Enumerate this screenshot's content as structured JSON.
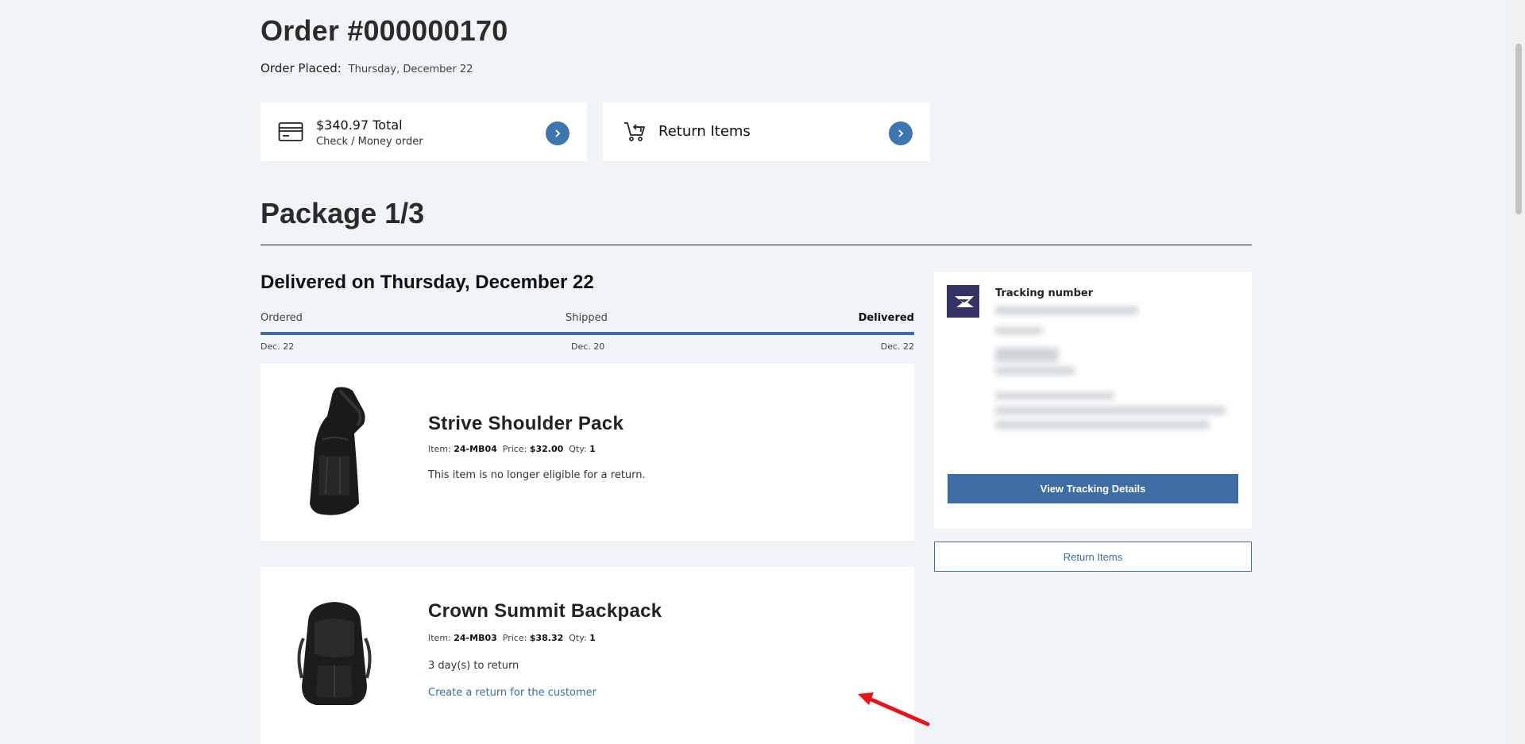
{
  "order": {
    "title": "Order #000000170",
    "placed_label": "Order Placed:",
    "placed_value": "Thursday, December 22"
  },
  "summary_cards": {
    "total_main": "$340.97 Total",
    "payment_method": "Check / Money order",
    "return_items_label": "Return Items",
    "icons": [
      "credit-card-icon",
      "cart-return-icon",
      "chevron-right-icon"
    ]
  },
  "package": {
    "title": "Package 1/3",
    "delivered_heading": "Delivered on Thursday, December 22",
    "progress": 1.0,
    "steps": [
      {
        "label": "Ordered",
        "date": "Dec. 22",
        "current": false
      },
      {
        "label": "Shipped",
        "date": "Dec. 20",
        "current": false
      },
      {
        "label": "Delivered",
        "date": "Dec. 22",
        "current": true
      }
    ]
  },
  "items": [
    {
      "name": "Strive Shoulder Pack",
      "item_label": "Item:",
      "sku": "24-MB04",
      "price_label": "Price:",
      "price": "$32.00",
      "qty_label": "Qty:",
      "qty": "1",
      "note": "This item is no longer eligible for a return."
    },
    {
      "name": "Crown Summit Backpack",
      "item_label": "Item:",
      "sku": "24-MB03",
      "price_label": "Price:",
      "price": "$38.32",
      "qty_label": "Qty:",
      "qty": "1",
      "note": "3 day(s) to return",
      "link": "Create a return for the customer"
    }
  ],
  "tracking": {
    "label": "Tracking number",
    "view_button": "View Tracking Details",
    "return_button": "Return Items",
    "carrier_icon": "usps-eagle-icon"
  },
  "colors": {
    "accent": "#3d6da3",
    "accent_circle": "#3d76b1",
    "background": "#f1f4f7",
    "usps": "#333366",
    "annotation": "#e8141b"
  }
}
